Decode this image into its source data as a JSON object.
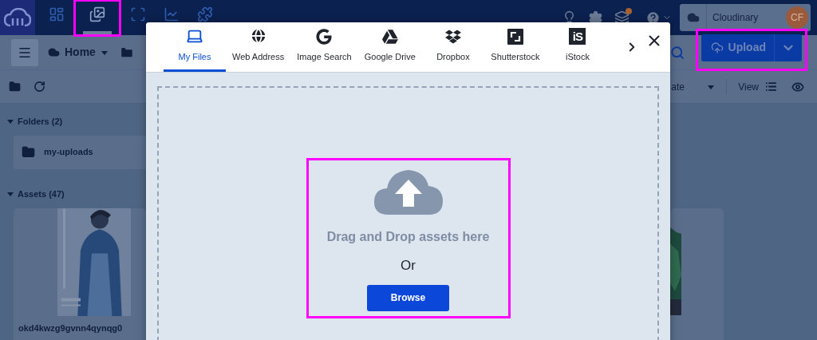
{
  "top_nav": {
    "items": [
      {
        "selected": false,
        "highlighted": false
      },
      {
        "selected": true,
        "highlighted": true
      },
      {
        "selected": false,
        "highlighted": false
      },
      {
        "selected": false,
        "highlighted": false
      },
      {
        "selected": false,
        "highlighted": false
      }
    ],
    "updates_badge": true,
    "account": {
      "name": "Cloudinary",
      "initials": "CF"
    }
  },
  "toolbar": {
    "folder": "Home",
    "upload_button": {
      "label": "Upload",
      "highlighted": true
    }
  },
  "view_bar": {
    "sort_label": "ate",
    "view_label": "View"
  },
  "folders": {
    "heading": "Folders (2)",
    "expanded": true,
    "items": [
      {
        "name": "my-uploads"
      }
    ]
  },
  "assets": {
    "heading": "Assets (47)",
    "expanded": true,
    "items": [
      {
        "kind": "picture",
        "name": "okd4kwzg9gvnn4qynqg0"
      },
      {
        "kind": "picture"
      }
    ]
  },
  "upload_dialog": {
    "tabs": [
      {
        "label": "My Files",
        "selected": true
      },
      {
        "label": "Web Address",
        "selected": false
      },
      {
        "label": "Image Search",
        "selected": false
      },
      {
        "label": "Google Drive",
        "selected": false
      },
      {
        "label": "Dropbox",
        "selected": false
      },
      {
        "label": "Shutterstock",
        "selected": false
      },
      {
        "label": "iStock",
        "selected": false,
        "logo_text": "iS"
      }
    ],
    "dropzone": {
      "title": "Drag and Drop assets here",
      "separator": "Or",
      "button": "Browse",
      "highlighted": true
    }
  }
}
